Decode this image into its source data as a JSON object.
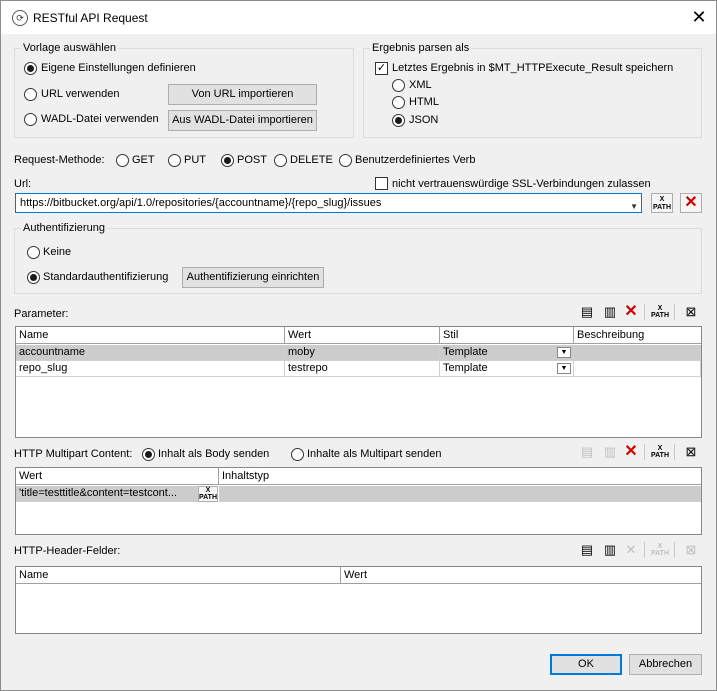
{
  "window": {
    "title": "RESTful API Request",
    "close_label": "✕"
  },
  "template": {
    "group_label": "Vorlage auswählen",
    "options": [
      "Eigene Einstellungen definieren",
      "URL verwenden",
      "WADL-Datei verwenden"
    ],
    "selected": "Eigene Einstellungen definieren",
    "import_url_button": "Von URL importieren",
    "import_wadl_button": "Aus WADL-Datei importieren"
  },
  "parse": {
    "group_label": "Ergebnis parsen als",
    "save_label": "Letztes Ergebnis in $MT_HTTPExecute_Result speichern",
    "save_checked": true,
    "options": [
      "XML",
      "HTML",
      "JSON"
    ],
    "selected": "JSON"
  },
  "method": {
    "label": "Request-Methode:",
    "options": [
      "GET",
      "PUT",
      "POST",
      "DELETE",
      "Benutzerdefiniertes Verb"
    ],
    "selected": "POST"
  },
  "url": {
    "label": "Url:",
    "ssl_label": "nicht vertrauenswürdige SSL-Verbindungen zulassen",
    "ssl_checked": false,
    "value": "https://bitbucket.org/api/1.0/repositories/{accountname}/{repo_slug}/issues"
  },
  "auth": {
    "group_label": "Authentifizierung",
    "options": [
      "Keine",
      "Standardauthentifizierung"
    ],
    "selected": "Standardauthentifizierung",
    "setup_button": "Authentifizierung einrichten"
  },
  "params": {
    "label": "Parameter:",
    "columns": [
      "Name",
      "Wert",
      "Stil",
      "Beschreibung"
    ],
    "rows": [
      {
        "name": "accountname",
        "value": "moby",
        "style": "Template",
        "description": ""
      },
      {
        "name": "repo_slug",
        "value": "testrepo",
        "style": "Template",
        "description": ""
      }
    ]
  },
  "multipart": {
    "label": "HTTP Multipart Content:",
    "options": [
      "Inhalt als Body senden",
      "Inhalte als Multipart senden"
    ],
    "selected": "Inhalt als Body senden",
    "columns": [
      "Wert",
      "Inhaltstyp"
    ],
    "rows": [
      {
        "value": "'title=testtitle&content=testcont...",
        "type": ""
      }
    ]
  },
  "headers": {
    "label": "HTTP-Header-Felder:",
    "columns": [
      "Name",
      "Wert"
    ]
  },
  "xpath_label": "X PATH",
  "footer": {
    "ok": "OK",
    "cancel": "Abbrechen"
  },
  "colors": {
    "selected_row": "#cccccc",
    "focus_border": "#0078d7",
    "delete_red": "#d40000"
  }
}
